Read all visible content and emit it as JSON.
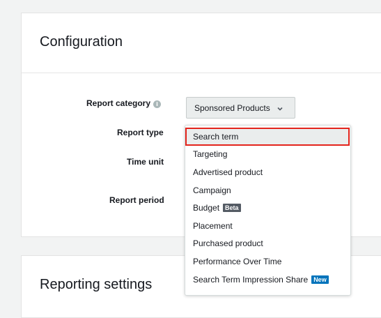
{
  "configuration": {
    "title": "Configuration",
    "fields": {
      "report_category_label": "Report category",
      "report_type_label": "Report type",
      "time_unit_label": "Time unit",
      "report_period_label": "Report period"
    },
    "report_category_value": "Sponsored Products"
  },
  "report_type_dropdown": {
    "items": [
      {
        "label": "Search term",
        "selected": true
      },
      {
        "label": "Targeting"
      },
      {
        "label": "Advertised product"
      },
      {
        "label": "Campaign"
      },
      {
        "label": "Budget",
        "badge": "Beta",
        "badge_color": "#545b64"
      },
      {
        "label": "Placement"
      },
      {
        "label": "Purchased product"
      },
      {
        "label": "Performance Over Time"
      },
      {
        "label": "Search Term Impression Share",
        "badge": "New",
        "badge_color": "#0073bb"
      }
    ]
  },
  "reporting_settings": {
    "title": "Reporting settings"
  },
  "colors": {
    "highlight_border": "#e3241c",
    "selected_bg": "#eaeded"
  },
  "icons": {
    "info": "info-icon",
    "chevron": "chevron-down-icon"
  }
}
